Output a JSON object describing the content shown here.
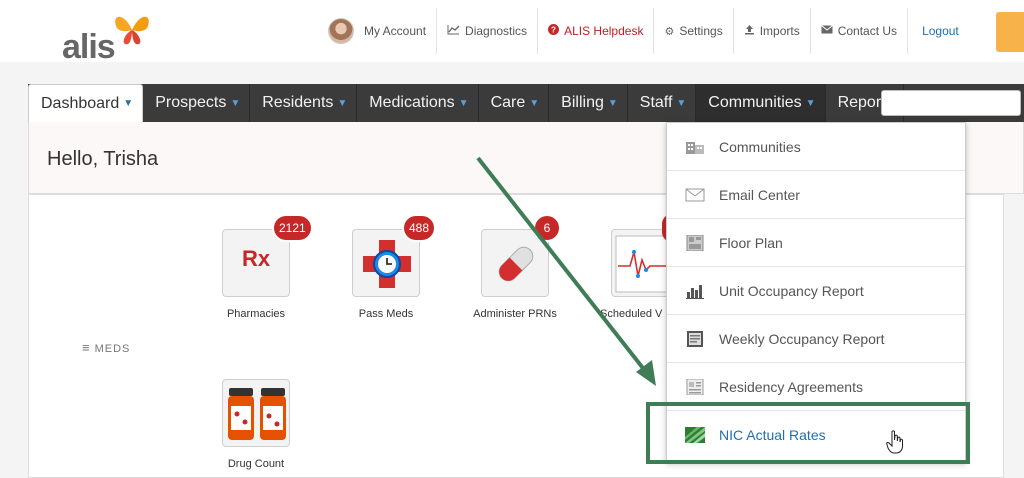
{
  "brand": {
    "logo_text": "alis"
  },
  "header": {
    "my_account": "My Account",
    "diagnostics": "Diagnostics",
    "helpdesk": "ALIS Helpdesk",
    "settings": "Settings",
    "imports": "Imports",
    "contact": "Contact Us",
    "logout": "Logout"
  },
  "nav": {
    "dashboard": "Dashboard",
    "prospects": "Prospects",
    "residents": "Residents",
    "medications": "Medications",
    "care": "Care",
    "billing": "Billing",
    "staff": "Staff",
    "communities": "Communities",
    "reports": "Reports"
  },
  "greeting": "Hello, Trisha",
  "section": {
    "meds_label": "MEDS"
  },
  "tiles": {
    "pharmacies": {
      "label": "Pharmacies",
      "badge": "2121",
      "glyph": "Rx"
    },
    "pass_meds": {
      "label": "Pass Meds",
      "badge": "488"
    },
    "administer_prns": {
      "label": "Administer PRNs",
      "badge": "6"
    },
    "scheduled": {
      "label": "Scheduled V"
    },
    "drug_count": {
      "label": "Drug Count"
    }
  },
  "dropdown": {
    "items": [
      {
        "label": "Communities",
        "icon": "building-icon"
      },
      {
        "label": "Email Center",
        "icon": "envelope-icon"
      },
      {
        "label": "Floor Plan",
        "icon": "floor-plan-icon"
      },
      {
        "label": "Unit Occupancy Report",
        "icon": "bar-chart-icon"
      },
      {
        "label": "Weekly Occupancy Report",
        "icon": "report-icon"
      },
      {
        "label": "Residency Agreements",
        "icon": "document-icon"
      },
      {
        "label": "NIC Actual Rates",
        "icon": "nic-icon"
      }
    ]
  },
  "colors": {
    "accent": "#1f6fb0",
    "badge": "#c62828",
    "highlight": "#3f7d57",
    "nav": "#3b3b3b"
  }
}
